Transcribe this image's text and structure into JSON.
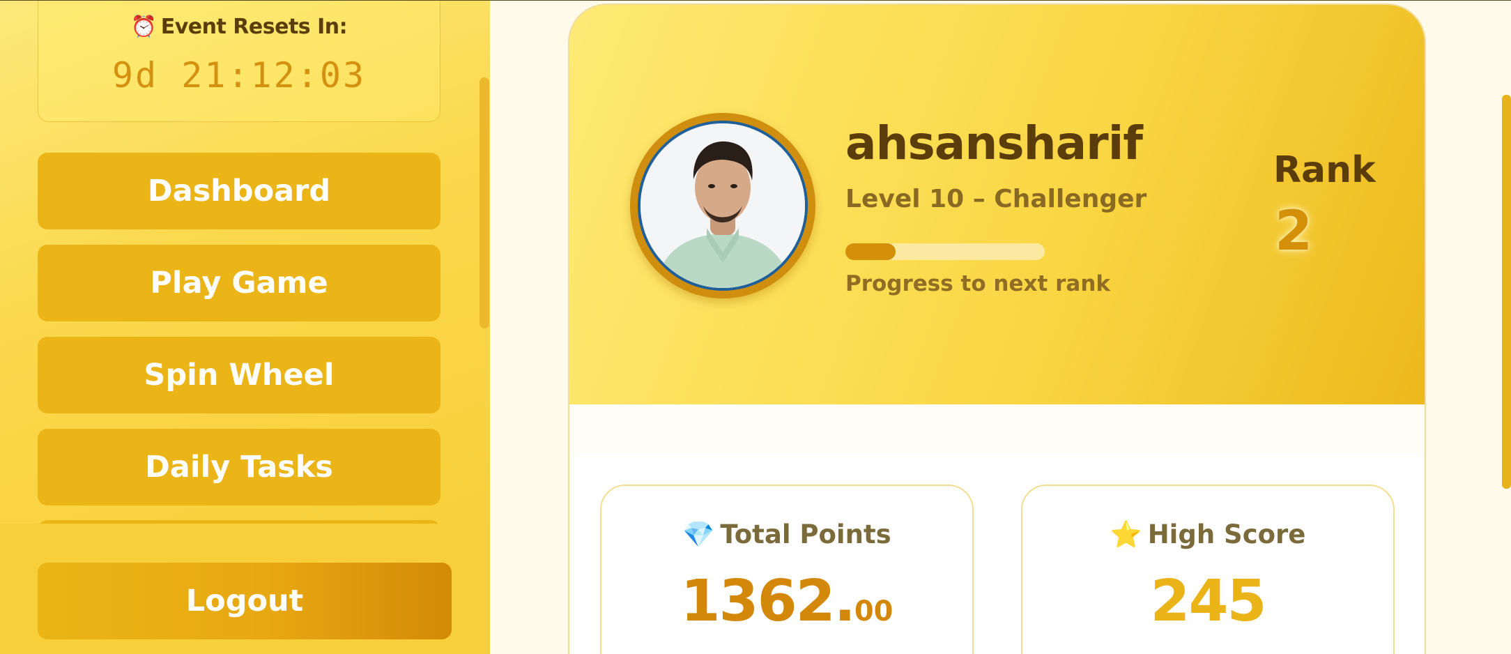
{
  "sidebar": {
    "timer": {
      "icon": "alarm-clock-icon",
      "title": "Event Resets In:",
      "value": "9d 21:12:03"
    },
    "nav_items": [
      {
        "label": "Dashboard"
      },
      {
        "label": "Play Game"
      },
      {
        "label": "Spin Wheel"
      },
      {
        "label": "Daily Tasks"
      }
    ],
    "logout_label": "Logout"
  },
  "profile": {
    "username": "ahsansharif",
    "level": "Level 10 – Challenger",
    "progress_fraction": 0.25,
    "progress_label": "Progress to next rank",
    "rank_label": "Rank",
    "rank_value": "2"
  },
  "stats": {
    "total_points": {
      "icon": "gem-icon",
      "title": "Total Points",
      "value_main": "1362.",
      "value_decimals": "00"
    },
    "high_score": {
      "icon": "star-icon",
      "title": "High Score",
      "value": "245"
    }
  },
  "colors": {
    "accent": "#ebb417",
    "accent_dark": "#d49008",
    "text_dark": "#5b3d0b",
    "sidebar_bg": "#fbd84c",
    "page_bg": "#fffaea"
  }
}
